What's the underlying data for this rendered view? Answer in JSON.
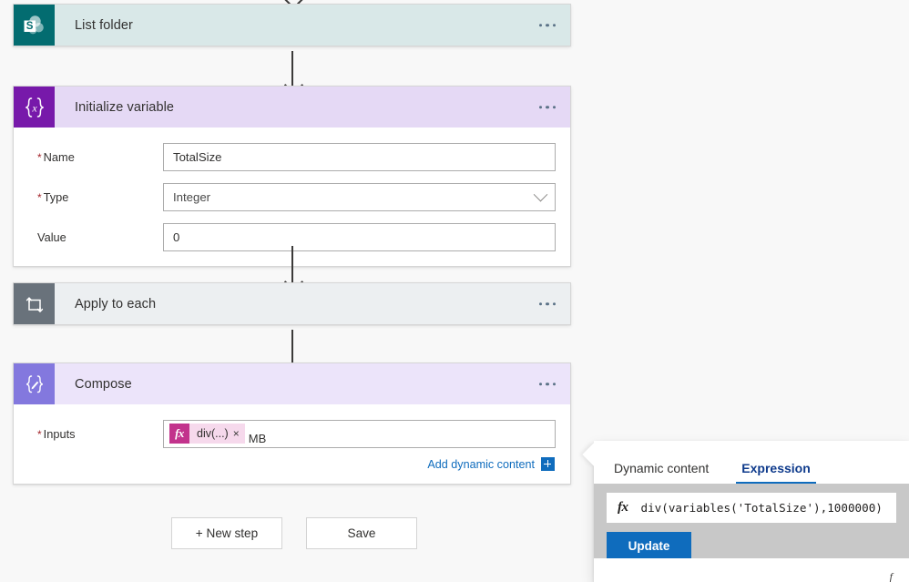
{
  "canvas": {
    "steps": [
      {
        "id": "list-folder",
        "title": "List folder",
        "icon": "sharepoint-icon",
        "header_color": "#d9e8e8",
        "icon_color": "#036c70"
      },
      {
        "id": "initialize-variable",
        "title": "Initialize variable",
        "icon": "variable-braces-icon",
        "header_color": "#e5d9f5",
        "icon_color": "#7719aa",
        "fields": [
          {
            "label": "Name",
            "required": true,
            "type": "text",
            "value": "TotalSize"
          },
          {
            "label": "Type",
            "required": true,
            "type": "dropdown",
            "value": "Integer"
          },
          {
            "label": "Value",
            "required": false,
            "type": "text",
            "value": "0"
          }
        ]
      },
      {
        "id": "apply-to-each",
        "title": "Apply to each",
        "icon": "loop-icon",
        "header_color": "#eceff1",
        "icon_color": "#69727b"
      },
      {
        "id": "compose",
        "title": "Compose",
        "icon": "compose-braces-icon",
        "header_color": "#ece4fa",
        "icon_color": "#8378de",
        "inputs_field": {
          "label": "Inputs",
          "required": true,
          "token": {
            "fx_glyph": "fx",
            "text": "div(...)",
            "remove_glyph": "×"
          },
          "suffix_text": "MB"
        },
        "dynamic_content_link": "Add dynamic content"
      }
    ],
    "buttons": {
      "new_step": "+ New step",
      "save": "Save"
    }
  },
  "flyout": {
    "tabs": [
      {
        "label": "Dynamic content",
        "active": false
      },
      {
        "label": "Expression",
        "active": true
      }
    ],
    "expression": {
      "fx_glyph": "fx",
      "value": "div(variables('TotalSize'),1000000)"
    },
    "update_button": "Update",
    "footer_hint": "",
    "accent_color": "#0f6cbd"
  }
}
